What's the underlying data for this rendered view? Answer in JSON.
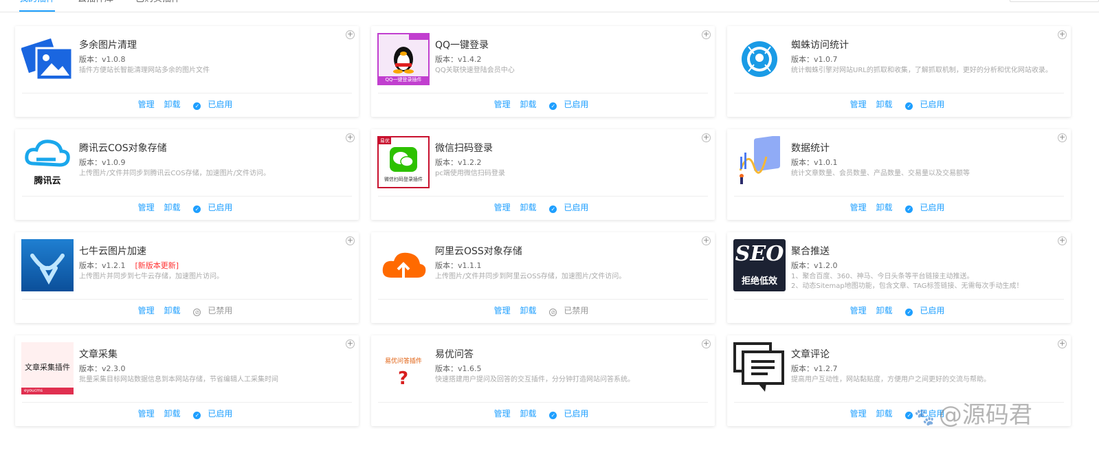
{
  "tabs": [
    "我的插件",
    "云插件库",
    "已购买插件"
  ],
  "labels": {
    "manage": "管理",
    "uninstall": "卸载"
  },
  "status_icons": {
    "enabled": "✓",
    "disabled": "⊘"
  },
  "plugins": [
    {
      "title": "多余图片清理",
      "version": "版本：v1.0.8",
      "desc": "插件方便站长智能清理网站多余的图片文件",
      "status": "已启用",
      "enabled": true,
      "icon": "images-icon",
      "icon_text": ""
    },
    {
      "title": "QQ一键登录",
      "version": "版本：v1.4.2",
      "desc": "QQ关联快速登陆会员中心",
      "status": "已启用",
      "enabled": true,
      "icon": "qq-penguin-icon",
      "icon_text": "QQ一键登录插件"
    },
    {
      "title": "蜘蛛访问统计",
      "version": "版本：v1.0.7",
      "desc": "统计蜘蛛引擎对网站URL的抓取和收集，了解抓取机制，更好的分析和优化网站收录。",
      "status": "已启用",
      "enabled": true,
      "icon": "spider-icon",
      "icon_text": ""
    },
    {
      "title": "腾讯云COS对象存储",
      "version": "版本：v1.0.9",
      "desc": "上传图片/文件并同步到腾讯云COS存储，加速图片/文件访问。",
      "status": "已启用",
      "enabled": true,
      "icon": "tencent-cloud-icon",
      "icon_text": "腾讯云"
    },
    {
      "title": "微信扫码登录",
      "version": "版本：v1.2.2",
      "desc": "pc端使用微信扫码登录",
      "status": "已启用",
      "enabled": true,
      "icon": "wechat-icon",
      "icon_text": "微信扫码登录插件",
      "badge": "易优"
    },
    {
      "title": "数据统计",
      "version": "版本：v1.0.1",
      "desc": "统计文章数量、会员数量、产品数量、交易量以及交易额等",
      "status": "已启用",
      "enabled": true,
      "icon": "data-chart-icon",
      "icon_text": ""
    },
    {
      "title": "七牛云图片加速",
      "version": "版本：v1.2.1",
      "update": "[新版本更新]",
      "desc": "上传图片并同步到七牛云存储，加速图片访问。",
      "status": "已禁用",
      "enabled": false,
      "icon": "qiniu-icon",
      "icon_text": ""
    },
    {
      "title": "阿里云OSS对象存储",
      "version": "版本：v1.1.1",
      "desc": "上传图片/文件并同步到阿里云OSS存储，加速图片/文件访问。",
      "status": "已禁用",
      "enabled": false,
      "icon": "aliyun-cloud-icon",
      "icon_text": ""
    },
    {
      "title": "聚合推送",
      "version": "版本：v1.2.0",
      "desc": "1、聚合百度、360、神马、今日头条等平台链接主动推送。",
      "desc2": "2、动态Sitemap地图功能，包含文章、TAG标签链接、无需每次手动生成！",
      "status": "已启用",
      "enabled": true,
      "icon": "seo-icon",
      "icon_text": "SEO",
      "icon_text2": "拒绝低效"
    },
    {
      "title": "文章采集",
      "version": "版本：v2.3.0",
      "desc": "批量采集目标网站数据信息到本网站存储，节省编辑人工采集时间",
      "status": "已启用",
      "enabled": true,
      "icon": "collect-icon",
      "icon_text": "文章采集插件",
      "icon_text2": "eyoucms"
    },
    {
      "title": "易优问答",
      "version": "版本：v1.6.5",
      "desc": "快速搭建用户提问及回答的交互插件，分分钟打造网站问答系统。",
      "status": "已启用",
      "enabled": true,
      "icon": "question-icon",
      "icon_text": "易优问答插件"
    },
    {
      "title": "文章评论",
      "version": "版本：v1.2.7",
      "desc": "提高用户互动性，网站黏贴度，方便用户之间更好的交流与帮助。",
      "status": "已启用",
      "enabled": true,
      "icon": "comment-icon",
      "icon_text": ""
    }
  ],
  "watermark": "@源码君",
  "colors": {
    "accent": "#1e9fff",
    "update": "#ff3333",
    "disabled": "#999999"
  }
}
